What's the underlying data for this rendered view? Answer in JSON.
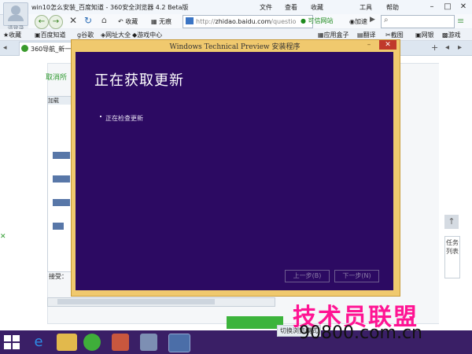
{
  "browser": {
    "title": "win10怎么安装_百度知道 - 360安全浏览器 4.2 Beta版",
    "avatar_label": "请登录",
    "menus": [
      "文件",
      "查看",
      "收藏",
      "工具",
      "帮助"
    ],
    "nav": {
      "favorites": "收藏",
      "noimage": "无痕",
      "address_host": "zhidao.baidu.com",
      "address_prefix": "http://",
      "address_rest": "/questio",
      "trusted_site": "可信网站",
      "accelerate": "加速"
    },
    "bookmarks_left": [
      "收藏",
      "百度知道",
      "谷歌",
      "网址大全",
      "游戏中心"
    ],
    "bookmarks_right": [
      "应用盒子",
      "翻译",
      "截图",
      "网银",
      "游戏"
    ],
    "tab_label": "360导航_新一代"
  },
  "page": {
    "cancel_link": "取消所",
    "thumb_header": "加载",
    "accept_label": "接受：",
    "right_tasklist": "任务列表"
  },
  "dialog": {
    "title": "Windows Technical Preview 安装程序",
    "heading": "正在获取更新",
    "status": "正在检查更新",
    "back_button": "上一步(B)",
    "next_button": "下一步(N)"
  },
  "taskbar": {
    "notification": "切换浏览模式"
  },
  "watermark": {
    "brand": "技术员联盟",
    "url": "90800.com.cn"
  }
}
